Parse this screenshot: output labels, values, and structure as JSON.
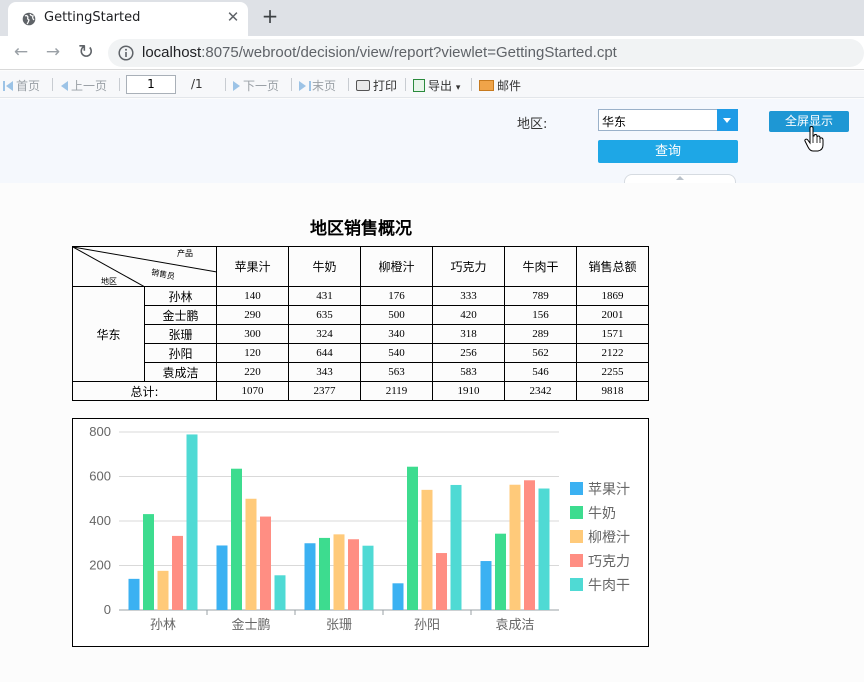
{
  "browser": {
    "tab_title": "GettingStarted",
    "tab_close": "✕",
    "new_tab": "+",
    "back": "←",
    "forward": "→",
    "reload": "↻",
    "url_host": "localhost",
    "url_rest": ":8075/webroot/decision/view/report?viewlet=GettingStarted.cpt"
  },
  "toolbar": {
    "first": "首页",
    "prev": "上一页",
    "page_value": "1",
    "page_total": "/1",
    "next": "下一页",
    "last": "末页",
    "print": "打印",
    "export": "导出",
    "export_arrow": "▾",
    "email": "邮件"
  },
  "params": {
    "region_label": "地区:",
    "region_value": "华东",
    "query_label": "查询",
    "fullscreen_label": "全屏显示"
  },
  "report": {
    "title": "地区销售概况",
    "corner_product": "产品",
    "corner_salesman": "销售员",
    "corner_region": "地区",
    "columns": [
      "苹果汁",
      "牛奶",
      "柳橙汁",
      "巧克力",
      "牛肉干",
      "销售总额"
    ],
    "region": "华东",
    "rows": [
      {
        "name": "孙林",
        "values": [
          "140",
          "431",
          "176",
          "333",
          "789",
          "1869"
        ]
      },
      {
        "name": "金士鹏",
        "values": [
          "290",
          "635",
          "500",
          "420",
          "156",
          "2001"
        ]
      },
      {
        "name": "张珊",
        "values": [
          "300",
          "324",
          "340",
          "318",
          "289",
          "1571"
        ]
      },
      {
        "name": "孙阳",
        "values": [
          "120",
          "644",
          "540",
          "256",
          "562",
          "2122"
        ]
      },
      {
        "name": "袁成洁",
        "values": [
          "220",
          "343",
          "563",
          "583",
          "546",
          "2255"
        ]
      }
    ],
    "total_label": "总计:",
    "totals": [
      "1070",
      "2377",
      "2119",
      "1910",
      "2342",
      "9818"
    ]
  },
  "chart_data": {
    "type": "bar",
    "categories": [
      "孙林",
      "金士鹏",
      "张珊",
      "孙阳",
      "袁成洁"
    ],
    "series": [
      {
        "name": "苹果汁",
        "color": "#3bb1f2",
        "values": [
          140,
          290,
          300,
          120,
          220
        ]
      },
      {
        "name": "牛奶",
        "color": "#3ddc8f",
        "values": [
          431,
          635,
          324,
          644,
          343
        ]
      },
      {
        "name": "柳橙汁",
        "color": "#ffca7a",
        "values": [
          176,
          500,
          340,
          540,
          563
        ]
      },
      {
        "name": "巧克力",
        "color": "#ff8e83",
        "values": [
          333,
          420,
          318,
          256,
          583
        ]
      },
      {
        "name": "牛肉干",
        "color": "#4fdad4",
        "values": [
          789,
          156,
          289,
          562,
          546
        ]
      }
    ],
    "y_ticks": [
      "0",
      "200",
      "400",
      "600",
      "800"
    ],
    "ylim": [
      0,
      800
    ],
    "grid": true,
    "legend": "right"
  }
}
